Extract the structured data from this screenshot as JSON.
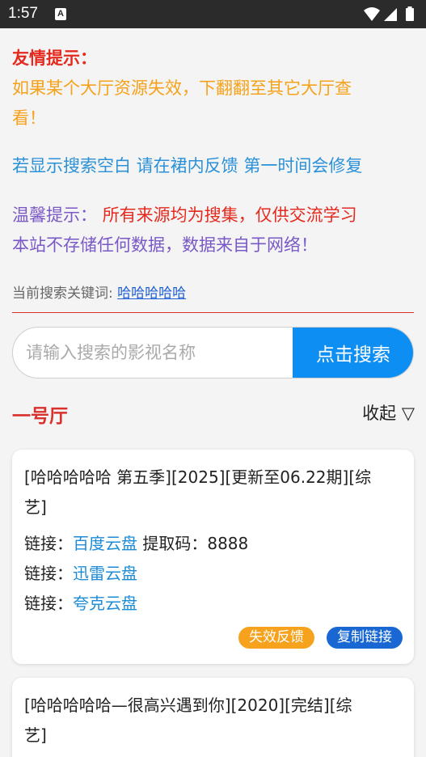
{
  "status_bar": {
    "time": "1:57",
    "notification_badge": "A"
  },
  "notices": {
    "title": "友情提示：",
    "line1": "如果某个大厅资源失效，下翻翻至其它大厅查",
    "line2": "看！",
    "feedback": "若显示搜索空白 请在裙内反馈 第一时间会修复",
    "warm_label": "温馨提示：",
    "warm_text": "所有来源均为搜集，仅供交流学习",
    "warm_line2": "本站不存储任何数据，数据来自于网络！"
  },
  "keyword": {
    "label": "当前搜索关键词: ",
    "value": "哈哈哈哈哈"
  },
  "search": {
    "placeholder": "请输入搜索的影视名称",
    "button_label": "点击搜索"
  },
  "hall": {
    "title": "一号厅",
    "collapse_label": "收起 ▽"
  },
  "results": [
    {
      "title_line1": "[哈哈哈哈哈 第五季][2025][更新至06.22期][综",
      "title_line2": "艺]",
      "link1": {
        "label": "链接：",
        "name": "百度云盘",
        "code_label": " 提取码：",
        "code": "8888"
      },
      "link2": {
        "label": "链接：",
        "name": "迅雷云盘"
      },
      "link3": {
        "label": "链接：",
        "name": "夸克云盘"
      },
      "report_label": "失效反馈",
      "copy_label": "复制链接"
    },
    {
      "title_line1": "[哈哈哈哈哈—很高兴遇到你][2020][完结][综",
      "title_line2": "艺]"
    }
  ]
}
